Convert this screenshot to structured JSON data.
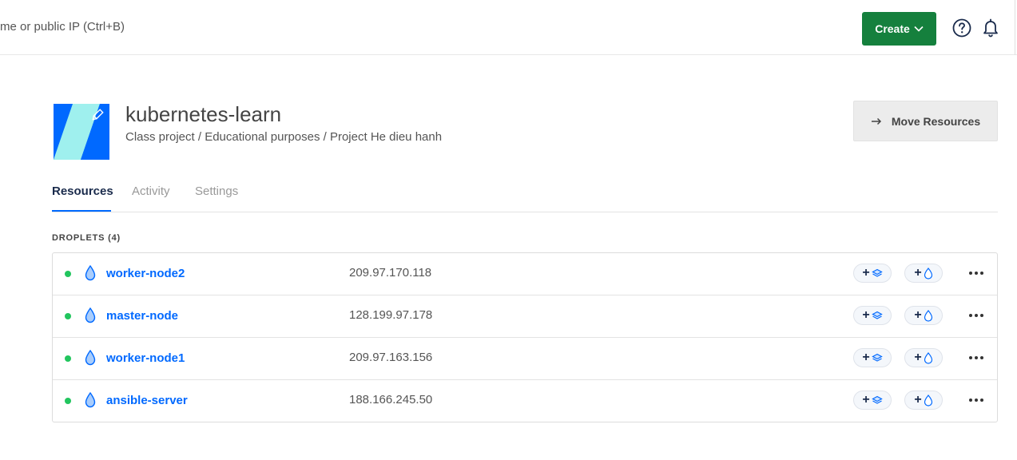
{
  "topbar": {
    "search_text": "me or public IP (Ctrl+B)",
    "create_label": "Create"
  },
  "project": {
    "name": "kubernetes-learn",
    "description": "Class project / Educational purposes / Project He dieu hanh",
    "move_label": "Move Resources"
  },
  "tabs": [
    {
      "label": "Resources",
      "active": true
    },
    {
      "label": "Activity",
      "active": false
    },
    {
      "label": "Settings",
      "active": false
    }
  ],
  "droplets_section": {
    "title": "DROPLETS (4)"
  },
  "droplets": [
    {
      "name": "worker-node2",
      "ip": "209.97.170.118",
      "status": "active"
    },
    {
      "name": "master-node",
      "ip": "128.199.97.178",
      "status": "active"
    },
    {
      "name": "worker-node1",
      "ip": "209.97.163.156",
      "status": "active"
    },
    {
      "name": "ansible-server",
      "ip": "188.166.245.50",
      "status": "active"
    }
  ],
  "colors": {
    "brand_blue": "#0069ff",
    "create_green": "#15803d",
    "status_green": "#22c55e",
    "logo_cyan": "#9ff0ee"
  },
  "icons": {
    "create_caret": "chevron-down-icon",
    "help": "help-icon",
    "notifications": "bell-icon",
    "move": "arrow-right-icon",
    "droplet": "droplet-icon",
    "add_volume": "volume-icon",
    "add_floating_ip": "floating-ip-icon",
    "more": "more-icon"
  }
}
